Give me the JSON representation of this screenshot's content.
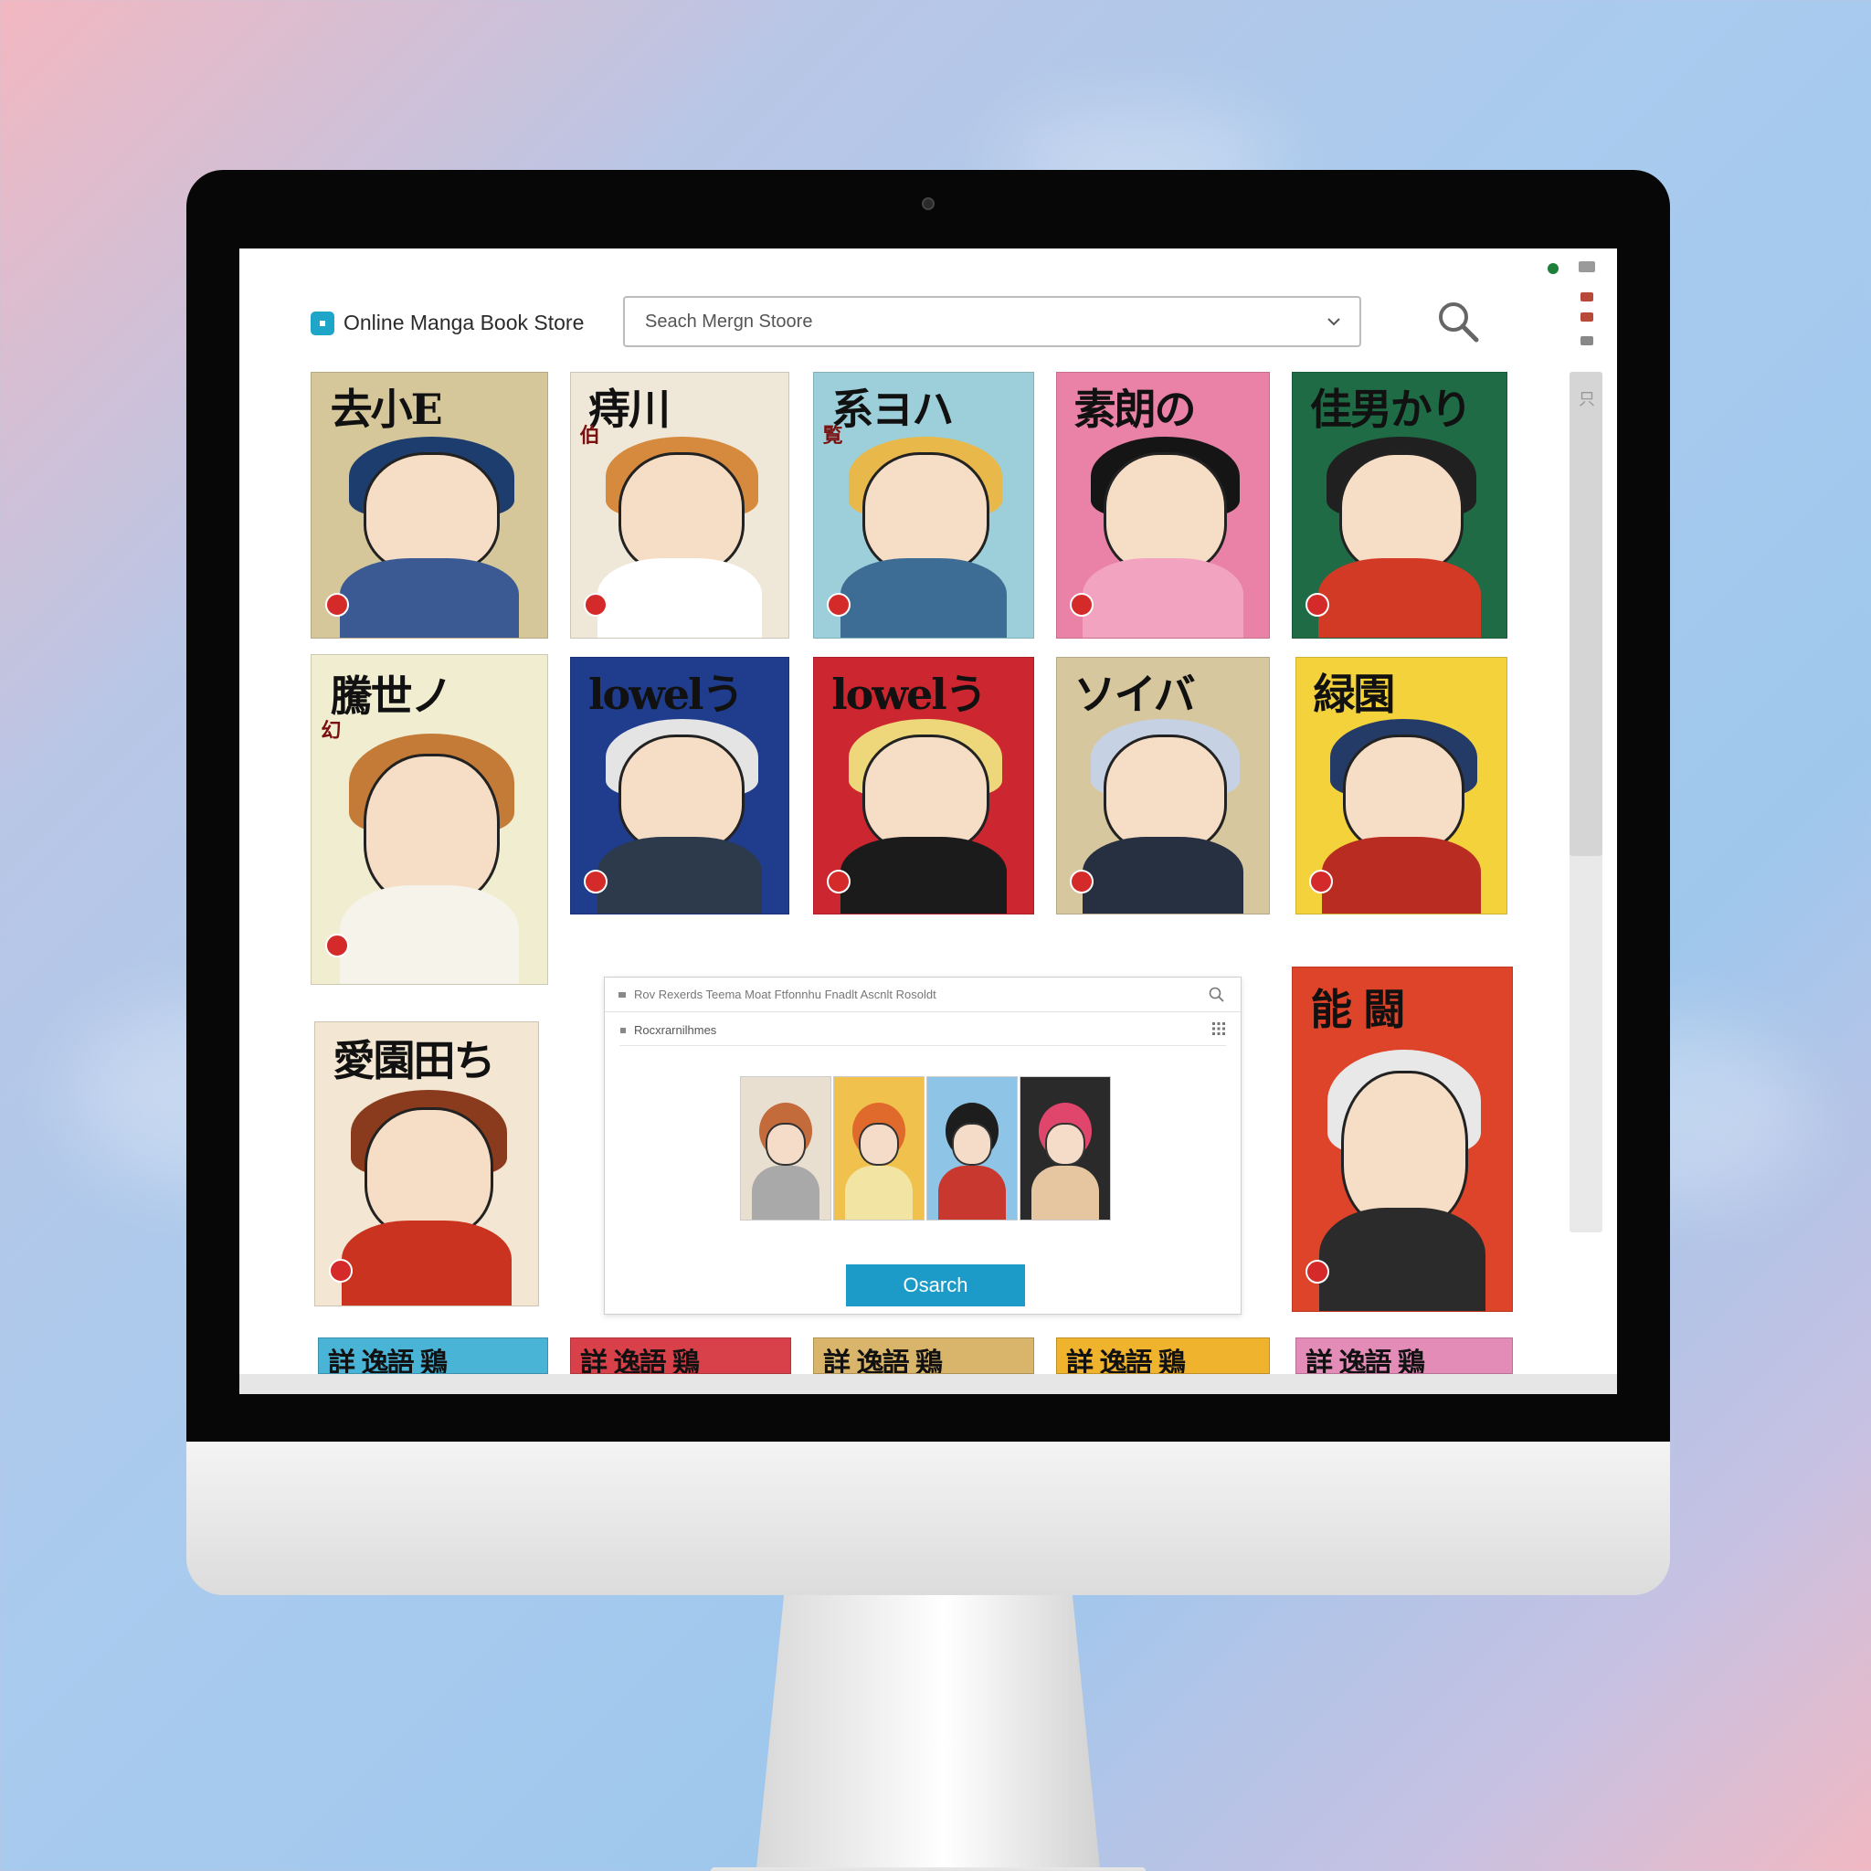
{
  "app": {
    "title": "Online Manga Book Store"
  },
  "search": {
    "placeholder": "Seach Mergn Stoore"
  },
  "colors": {
    "accent": "#1c9bc8",
    "status_dot": "#1e7f3a"
  },
  "covers_row1": [
    {
      "title": "去小E",
      "side": "",
      "bg": "#d6c79a",
      "hair": "#1c3d6e",
      "body": "#3b5a93"
    },
    {
      "title": "痔川",
      "side": "伯",
      "bg": "#efe8d8",
      "hair": "#d58a3d",
      "body": "#ffffff"
    },
    {
      "title": "系ヨハ",
      "side": "覧",
      "bg": "#9ccfd9",
      "hair": "#e8b84a",
      "body": "#3d6c95"
    },
    {
      "title": "素朗の",
      "side": "",
      "bg": "#e982a6",
      "hair": "#151515",
      "body": "#f2a3c0"
    },
    {
      "title": "佳男かり",
      "side": "",
      "bg": "#1f6b45",
      "hair": "#202020",
      "body": "#d33a26"
    }
  ],
  "covers_row2": [
    {
      "title": "騰世ノ",
      "side": "幻",
      "bg": "#f1edd0",
      "hair": "#c57b38",
      "body": "#f6f3ea"
    },
    {
      "title": "lowelう",
      "side": "",
      "bg": "#1f3d8c",
      "hair": "#e4e4e4",
      "body": "#2c3a4c"
    },
    {
      "title": "lowelう",
      "side": "",
      "bg": "#cc2630",
      "hair": "#eed77a",
      "body": "#1b1b1b"
    },
    {
      "title": "ソイバ",
      "side": "",
      "bg": "#d7c79f",
      "hair": "#c6d2e4",
      "body": "#263041"
    },
    {
      "title": "緑園",
      "side": "",
      "bg": "#f3d23c",
      "hair": "#233b66",
      "body": "#b92c22"
    }
  ],
  "covers_row3": [
    {
      "title": "愛園田ち",
      "side": "",
      "bg": "#f3e6d2",
      "hair": "#8a3b1d",
      "body": "#c9331f"
    },
    {
      "title": "能 闘",
      "side": "",
      "bg": "#dd4429",
      "hair": "#e8e8e8",
      "body": "#2b2b2b"
    }
  ],
  "strips": [
    {
      "text": "詳 逸語 鶏",
      "bg": "#4ab4d6"
    },
    {
      "text": "詳 逸語 鶏",
      "bg": "#d9414a"
    },
    {
      "text": "詳 逸語 鶏",
      "bg": "#d8b56a"
    },
    {
      "text": "詳 逸語 鶏",
      "bg": "#f0b32e"
    },
    {
      "text": "詳 逸語 鶏",
      "bg": "#e48cb8"
    }
  ],
  "popup": {
    "title": "Rov Rexerds Teema Moat Ftfonnhu Fnadlt Ascnlt Rosoldt",
    "subtitle": "Rocxrarnilhmes",
    "button_label": "Osarch",
    "thumbs": [
      {
        "bg": "#e9dfd0",
        "hair": "#c46b3c",
        "body": "#a9a9a9"
      },
      {
        "bg": "#f0c24d",
        "hair": "#e06a2b",
        "body": "#f2e4a2"
      },
      {
        "bg": "#8ec4e5",
        "hair": "#1d1d1d",
        "body": "#c9382e"
      },
      {
        "bg": "#2a2a2a",
        "hair": "#e0466b",
        "body": "#e6c6a0"
      }
    ]
  },
  "side_glyph": "只"
}
